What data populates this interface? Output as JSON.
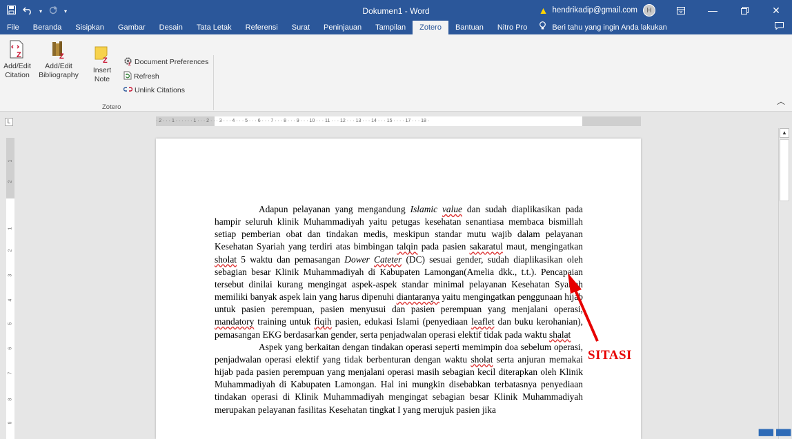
{
  "window": {
    "title": "Dokumen1 - Word",
    "account": "hendrikadip@gmail.com",
    "avatar_initial": "H"
  },
  "tabs": [
    "File",
    "Beranda",
    "Sisipkan",
    "Gambar",
    "Desain",
    "Tata Letak",
    "Referensi",
    "Surat",
    "Peninjauan",
    "Tampilan",
    "Zotero",
    "Bantuan",
    "Nitro Pro"
  ],
  "active_tab": "Zotero",
  "tell_me": "Beri tahu yang ingin Anda lakukan",
  "ribbon": {
    "add_edit_citation": [
      "Add/Edit",
      "Citation"
    ],
    "add_edit_bibliography": [
      "Add/Edit",
      "Bibliography"
    ],
    "insert_note": [
      "Insert",
      "Note"
    ],
    "document_preferences": "Document Preferences",
    "refresh": "Refresh",
    "unlink_citations": "Unlink Citations",
    "group_label": "Zotero"
  },
  "ruler": {
    "horizontal": "· 2 · · · 1 · · ·   · · · 1 · · · 2 · · · 3 · · · 4 · · · 5 · · · 6 · · · 7 · · · 8 · · · 9 · · · 10 · · · 11 · · · 12 · · · 13 · · · 14 · · · 15 ·   · · · 17 · · · 18 ·",
    "vertical": [
      "2",
      "1",
      "1",
      "2",
      "3",
      "4",
      "5",
      "6",
      "7",
      "8",
      "9"
    ]
  },
  "document": {
    "p1_a": "Adapun pelayanan yang mengandung ",
    "p1_islamic": "Islamic",
    "p1_value": "value",
    "p1_b": " dan sudah diaplikasikan pada hampir seluruh klinik Muhammadiyah yaitu petugas kesehatan senantiasa membaca bismillah setiap pemberian obat dan tindakan medis, meskipun standar mutu wajib dalam pelayanan Kesehatan Syariah yang terdiri atas bimbingan ",
    "p1_talqin": "talqin",
    "p1_c": " pada pasien ",
    "p1_sakaratul": "sakaratul",
    "p1_d": " maut, mengingatkan ",
    "p1_sholat": "sholat",
    "p1_e": " 5 waktu dan pemasangan ",
    "p1_dower": "Dower",
    "p1_cateter": "Cateter",
    "p1_f": " (DC) sesuai gender, sudah diaplikasikan oleh sebagian besar Klinik Muhammadiyah di Kabupaten Lamongan(Amelia dkk., t.t.). Pencapaian tersebut dinilai kurang mengingat aspek-aspek standar minimal pelayanan Kesehatan Syariah memiliki banyak aspek lain yang harus dipenuhi ",
    "p1_diantaranya": "diantaranya",
    "p1_g": " yaitu mengingatkan penggunaan hijab untuk pasien perempuan, pasien menyusui dan pasien perempuan yang menjalani operasi, ",
    "p1_mandatory": "mandatory",
    "p1_h": " training untuk ",
    "p1_fiqih": "fiqih",
    "p1_i": " pasien, edukasi Islami (penyediaan ",
    "p1_leaflet": "leaflet",
    "p1_j": " dan buku kerohanian), pemasangan EKG berdasarkan gender, serta penjadwalan operasi elektif tidak pada waktu ",
    "p1_shalat": "shalat",
    "p2_a": "Aspek yang berkaitan dengan tindakan operasi seperti memimpin doa sebelum operasi, penjadwalan operasi elektif yang tidak berbenturan dengan waktu ",
    "p2_sholat": "sholat",
    "p2_b": " serta anjuran memakai hijab pada pasien perempuan yang menjalani operasi masih sebagian kecil diterapkan oleh Klinik Muhammadiyah di Kabupaten Lamongan. Hal ini mungkin disebabkan terbatasnya penyediaan tindakan operasi di Klinik Muhammadiyah mengingat sebagian besar Klinik Muhammadiyah merupakan pelayanan fasilitas Kesehatan tingkat I yang merujuk pasien jika"
  },
  "annotation": {
    "label": "SITASI",
    "color": "#e60000"
  },
  "colors": {
    "word_blue": "#2b579a"
  }
}
